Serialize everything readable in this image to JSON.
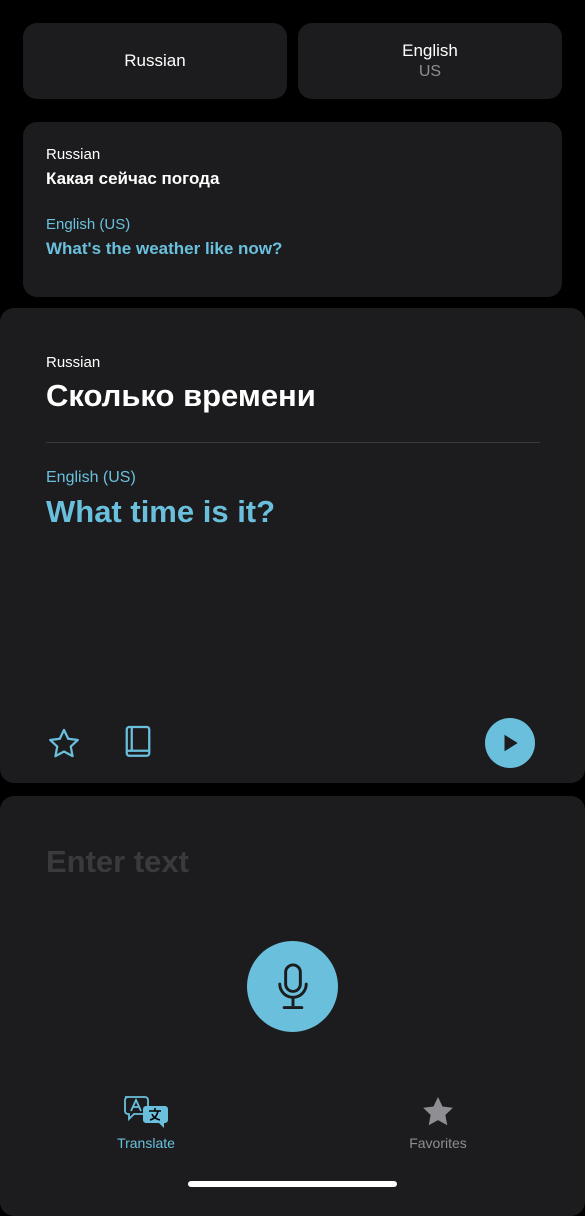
{
  "language_selector": {
    "source": {
      "label": "Russian"
    },
    "target": {
      "label": "English",
      "region": "US"
    }
  },
  "history": {
    "source_label": "Russian",
    "source_text": "Какая сейчас погода",
    "target_label": "English (US)",
    "target_text": "What's the weather like now?"
  },
  "current": {
    "source_label": "Russian",
    "source_text": "Сколько времени",
    "target_label": "English (US)",
    "target_text": "What time is it?"
  },
  "input": {
    "placeholder": "Enter text",
    "value": ""
  },
  "tabs": [
    {
      "label": "Translate",
      "icon": "translate-icon",
      "active": true
    },
    {
      "label": "Favorites",
      "icon": "star-icon",
      "active": false
    }
  ],
  "icons": {
    "favorite": "star-outline-icon",
    "dictionary": "book-icon",
    "play": "play-icon",
    "microphone": "microphone-icon"
  },
  "colors": {
    "accent": "#6ac0dc",
    "card": "#1c1c1e",
    "background": "#000000",
    "secondary_text": "#8e8e93"
  }
}
